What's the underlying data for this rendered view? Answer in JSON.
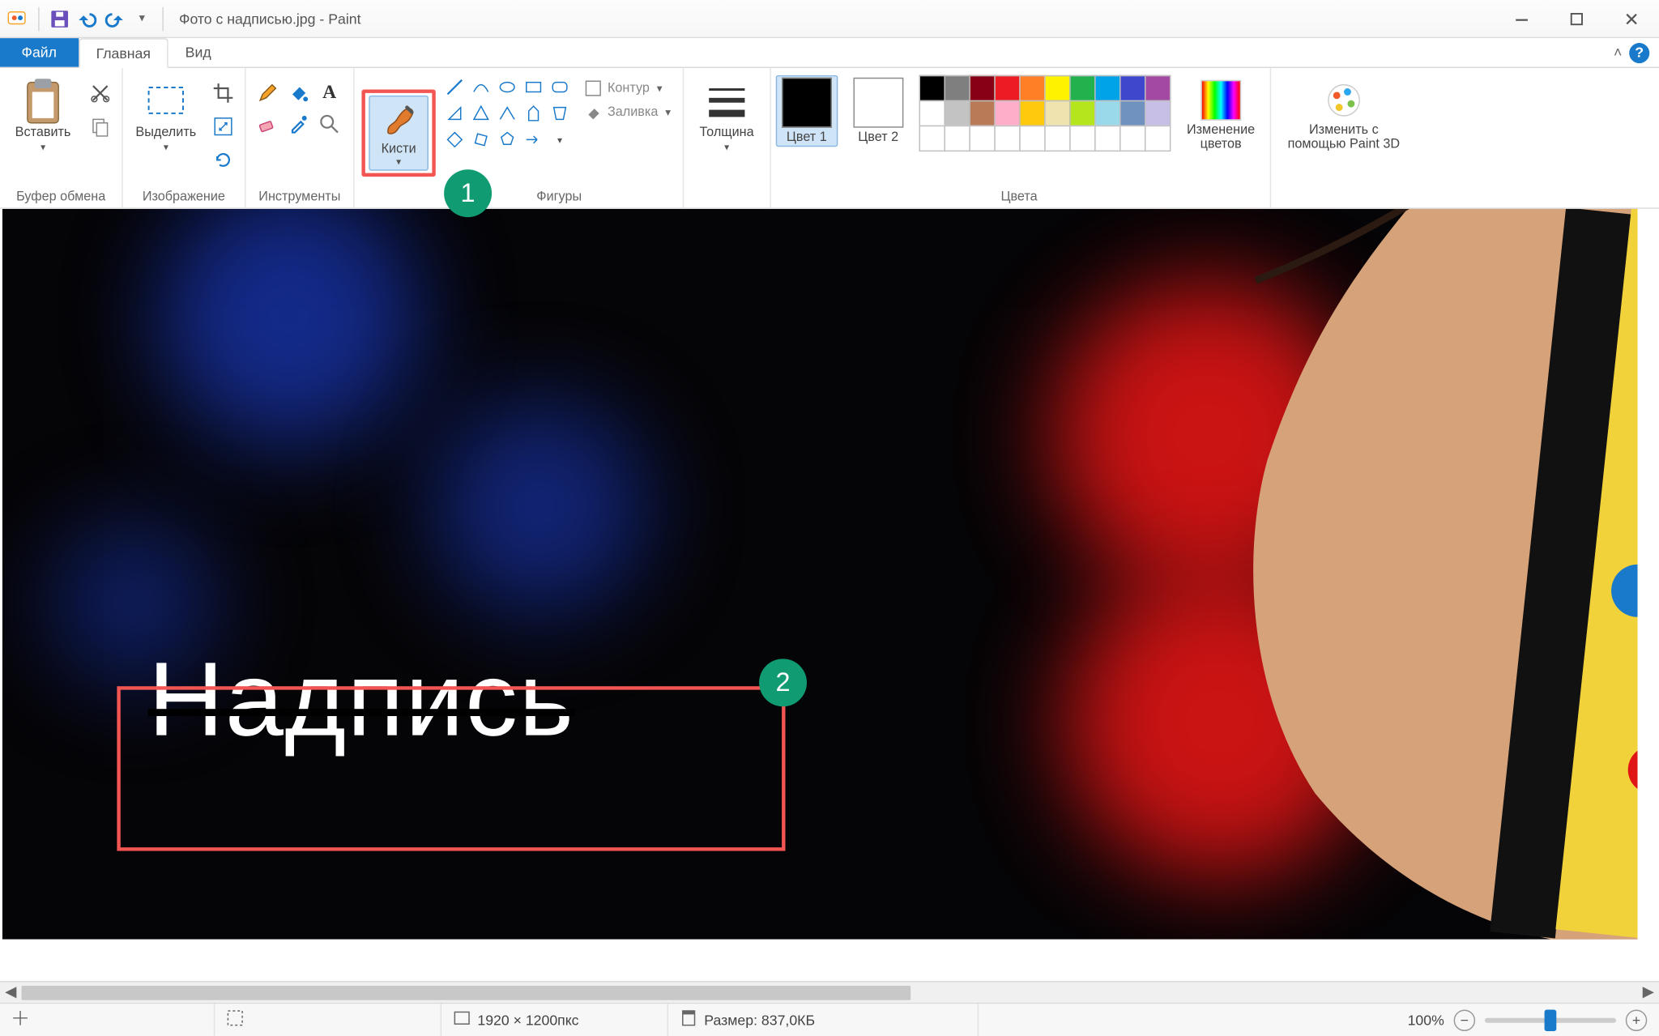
{
  "app": {
    "name": "Paint",
    "document": "Фото с надписью.jpg",
    "title_sep": " - "
  },
  "tabs": {
    "file": "Файл",
    "home": "Главная",
    "view": "Вид"
  },
  "ribbon": {
    "clipboard": {
      "paste": "Вставить",
      "group": "Буфер обмена"
    },
    "image": {
      "select": "Выделить",
      "group": "Изображение"
    },
    "tools": {
      "group": "Инструменты"
    },
    "brushes": {
      "label": "Кисти"
    },
    "shapes": {
      "outline": "Контур",
      "fill": "Заливка",
      "group": "Фигуры"
    },
    "size": {
      "label": "Толщина"
    },
    "colors": {
      "color1": "Цвет 1",
      "color2": "Цвет 2",
      "edit": "Изменение цветов",
      "group": "Цвета",
      "palette_top": [
        "#000000",
        "#7f7f7f",
        "#880015",
        "#ed1c24",
        "#ff7f27",
        "#fff200",
        "#22b14c",
        "#00a2e8",
        "#3f48cc",
        "#a349a4"
      ],
      "palette_mid": [
        "#ffffff",
        "#c3c3c3",
        "#b97a57",
        "#ffaec9",
        "#ffc90e",
        "#efe4b0",
        "#b5e61d",
        "#99d9ea",
        "#7092be",
        "#c8bfe7"
      ],
      "current1": "#000000",
      "current2": "#ffffff"
    },
    "paint3d": {
      "label": "Изменить с помощью Paint 3D"
    }
  },
  "canvas": {
    "overlay_text": "Надпись"
  },
  "callouts": {
    "one": "1",
    "two": "2"
  },
  "status": {
    "dimensions": "1920 × 1200пкс",
    "size_label": "Размер:",
    "size_value": "837,0КБ",
    "zoom": "100%"
  }
}
